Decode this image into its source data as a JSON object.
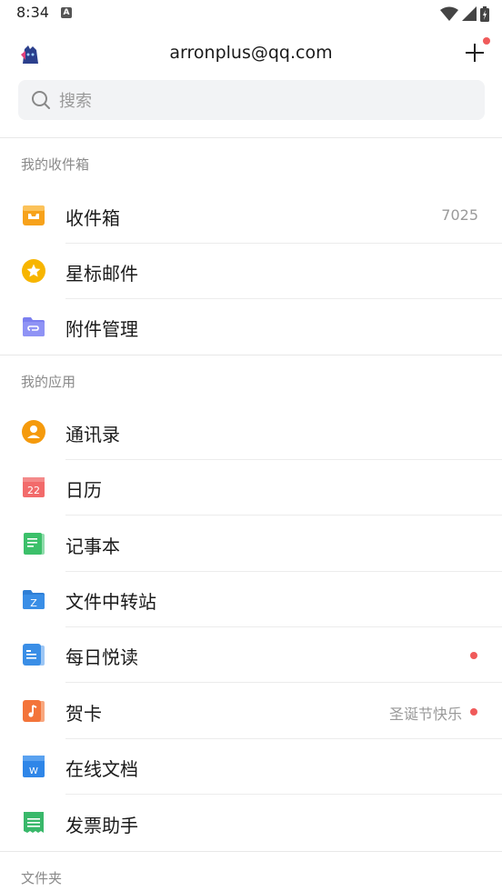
{
  "status": {
    "time": "8:34"
  },
  "header": {
    "account": "arronplus@qq.com"
  },
  "search": {
    "placeholder": "搜索"
  },
  "sections": {
    "inbox_section": "我的收件箱",
    "apps_section": "我的应用",
    "folders_section": "文件夹"
  },
  "inbox_items": [
    {
      "label": "收件箱",
      "count": "7025",
      "icon": "inbox-tray-icon"
    },
    {
      "label": "星标邮件",
      "icon": "star-icon"
    },
    {
      "label": "附件管理",
      "icon": "attachment-folder-icon"
    }
  ],
  "app_items": [
    {
      "label": "通讯录",
      "icon": "contacts-icon"
    },
    {
      "label": "日历",
      "icon": "calendar-icon",
      "icon_text": "22"
    },
    {
      "label": "记事本",
      "icon": "notepad-icon"
    },
    {
      "label": "文件中转站",
      "icon": "file-transfer-icon",
      "icon_text": "Z"
    },
    {
      "label": "每日悦读",
      "icon": "daily-reading-icon",
      "dot": true
    },
    {
      "label": "贺卡",
      "icon": "greeting-card-icon",
      "sub": "圣诞节快乐",
      "dot": true
    },
    {
      "label": "在线文档",
      "icon": "online-doc-icon",
      "icon_text": "W"
    },
    {
      "label": "发票助手",
      "icon": "invoice-icon"
    }
  ],
  "colors": {
    "inbox": "#f7a21b",
    "star": "#f7b500",
    "attachment": "#7b7ff0",
    "contacts": "#f59a0c",
    "calendar": "#f26b6b",
    "notepad": "#3cc06a",
    "file_transfer": "#3a8ee6",
    "daily_reading": "#3a8ee6",
    "greeting_card": "#f3743a",
    "online_doc": "#2f86e8",
    "invoice": "#39b86a",
    "red_dot": "#f05a5a"
  }
}
